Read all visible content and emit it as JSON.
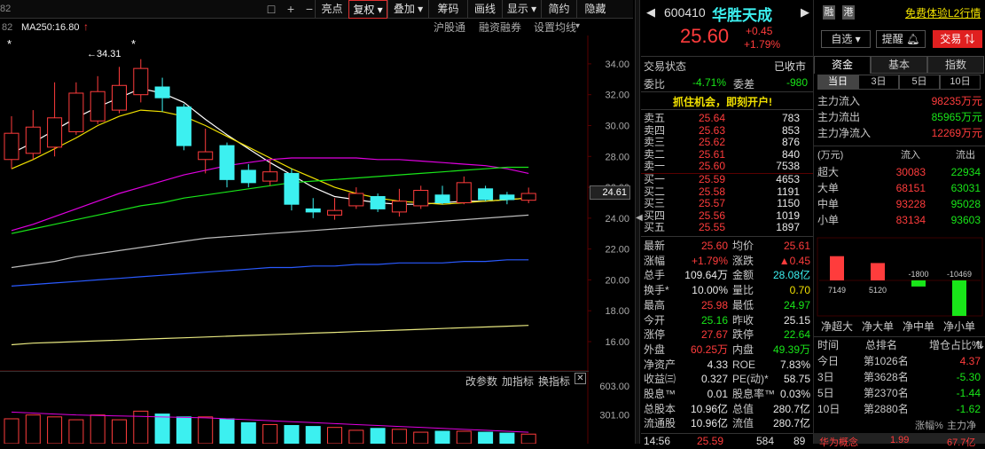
{
  "toolbar": {
    "left_num": "82",
    "icons": [
      "□",
      "+",
      "−"
    ],
    "buttons": [
      "亮点",
      "复权",
      "叠加",
      "筹码",
      "画线",
      "显示",
      "简约",
      "隐藏"
    ],
    "active": "复权"
  },
  "ma_label": "MA250:16.80",
  "sub_links": [
    "沪股通",
    "融资融券",
    "设置均线"
  ],
  "price_marker": "24.61",
  "high_label": "34.31",
  "ind_links": [
    "改参数",
    "加指标",
    "换指标"
  ],
  "chart_data": [
    {
      "type": "candlestick",
      "y_ticks": [
        "34.00",
        "32.00",
        "30.00",
        "28.00",
        "26.00",
        "24.00",
        "22.00",
        "20.00",
        "18.00",
        "16.00"
      ],
      "ylim": [
        16.0,
        34.8
      ],
      "candles": [
        {
          "o": 27.8,
          "c": 29.5,
          "h": 30.6,
          "l": 27.2
        },
        {
          "o": 28.2,
          "c": 29.9,
          "h": 31.0,
          "l": 27.8
        },
        {
          "o": 28.6,
          "c": 30.5,
          "h": 32.8,
          "l": 28.0
        },
        {
          "o": 29.6,
          "c": 32.1,
          "h": 32.8,
          "l": 29.4
        },
        {
          "o": 30.3,
          "c": 32.2,
          "h": 33.2,
          "l": 30.1
        },
        {
          "o": 31.0,
          "c": 32.6,
          "h": 33.8,
          "l": 30.8
        },
        {
          "o": 32.0,
          "c": 33.7,
          "h": 34.3,
          "l": 31.5
        },
        {
          "o": 32.5,
          "c": 31.8,
          "h": 33.1,
          "l": 30.9
        },
        {
          "o": 31.2,
          "c": 28.7,
          "h": 31.4,
          "l": 28.4
        },
        {
          "o": 27.8,
          "c": 28.3,
          "h": 29.8,
          "l": 26.9
        },
        {
          "o": 28.7,
          "c": 26.5,
          "h": 28.9,
          "l": 26.0
        },
        {
          "o": 27.1,
          "c": 26.3,
          "h": 27.5,
          "l": 26.0
        },
        {
          "o": 26.4,
          "c": 27.0,
          "h": 27.8,
          "l": 26.1
        },
        {
          "o": 26.9,
          "c": 24.9,
          "h": 27.2,
          "l": 24.5
        },
        {
          "o": 24.6,
          "c": 24.4,
          "h": 25.3,
          "l": 24.0
        },
        {
          "o": 24.2,
          "c": 24.5,
          "h": 25.3,
          "l": 23.9
        },
        {
          "o": 24.8,
          "c": 25.6,
          "h": 26.0,
          "l": 24.6
        },
        {
          "o": 25.4,
          "c": 24.6,
          "h": 25.6,
          "l": 24.4
        },
        {
          "o": 24.4,
          "c": 25.1,
          "h": 25.9,
          "l": 24.1
        },
        {
          "o": 24.8,
          "c": 25.8,
          "h": 26.1,
          "l": 24.6
        },
        {
          "o": 25.5,
          "c": 25.0,
          "h": 26.1,
          "l": 24.9
        },
        {
          "o": 25.0,
          "c": 26.3,
          "h": 26.7,
          "l": 24.9
        },
        {
          "o": 25.9,
          "c": 25.2,
          "h": 26.1,
          "l": 25.1
        },
        {
          "o": 25.5,
          "c": 25.2,
          "h": 25.7,
          "l": 24.9
        },
        {
          "o": 25.16,
          "c": 25.6,
          "h": 25.98,
          "l": 24.97
        }
      ],
      "lines": [
        {
          "color": "#ffffff",
          "values": [
            28.2,
            28.9,
            29.7,
            30.5,
            31.2,
            31.8,
            32.4,
            32.1,
            31.5,
            30.4,
            29.4,
            28.5,
            27.6,
            26.8,
            26.0,
            25.4,
            25.2,
            25.0,
            24.9,
            24.9,
            25.0,
            25.1,
            25.1,
            25.2,
            25.3
          ]
        },
        {
          "color": "#f0e000",
          "values": [
            27.2,
            27.8,
            28.5,
            29.2,
            30.0,
            30.6,
            31.0,
            30.9,
            30.6,
            30.0,
            29.3,
            28.6,
            27.9,
            27.2,
            26.6,
            26.0,
            25.6,
            25.3,
            25.1,
            25.0,
            24.9,
            25.0,
            25.1,
            25.2,
            25.3
          ]
        },
        {
          "color": "#e000e0",
          "values": [
            23.2,
            23.6,
            24.1,
            24.6,
            25.1,
            25.6,
            26.0,
            26.4,
            26.8,
            27.1,
            27.4,
            27.6,
            27.8,
            27.9,
            27.9,
            27.9,
            27.9,
            27.8,
            27.8,
            27.7,
            27.6,
            27.5,
            27.4,
            27.2,
            26.9
          ]
        },
        {
          "color": "#19e619",
          "values": [
            23.0,
            23.3,
            23.6,
            23.9,
            24.2,
            24.5,
            24.8,
            25.0,
            25.3,
            25.5,
            25.7,
            25.9,
            26.1,
            26.3,
            26.4,
            26.5,
            26.6,
            26.7,
            26.8,
            26.9,
            27.0,
            27.1,
            27.2,
            27.3,
            27.3
          ]
        },
        {
          "color": "#bbbbbb",
          "values": [
            20.8,
            21.0,
            21.2,
            21.5,
            21.7,
            21.9,
            22.1,
            22.3,
            22.5,
            22.7,
            22.8,
            22.9,
            23.0,
            23.1,
            23.2,
            23.3,
            23.4,
            23.5,
            23.6,
            23.7,
            23.8,
            23.9,
            24.0,
            24.1,
            24.2
          ]
        },
        {
          "color": "#2a5aff",
          "values": [
            19.6,
            19.7,
            19.8,
            19.9,
            20.0,
            20.1,
            20.2,
            20.3,
            20.4,
            20.5,
            20.6,
            20.7,
            20.8,
            20.8,
            20.9,
            20.9,
            21.0,
            21.0,
            21.1,
            21.1,
            21.1,
            21.2,
            21.2,
            21.3,
            21.3
          ]
        },
        {
          "color": "#e8e880",
          "values": [
            15.8,
            15.9,
            15.95,
            16.0,
            16.05,
            16.1,
            16.15,
            16.2,
            16.25,
            16.3,
            16.35,
            16.4,
            16.45,
            16.5,
            16.55,
            16.6,
            16.65,
            16.7,
            16.75,
            16.8,
            16.85,
            16.9,
            16.95,
            17.0,
            17.05
          ]
        }
      ]
    },
    {
      "type": "bar",
      "y_ticks": [
        "603.00",
        "301.00"
      ],
      "ylim": [
        0,
        603
      ],
      "volumes": [
        260,
        300,
        280,
        250,
        300,
        250,
        340,
        310,
        280,
        280,
        260,
        220,
        200,
        190,
        180,
        170,
        140,
        160,
        150,
        120,
        130,
        130,
        120,
        110,
        100
      ],
      "ma_line": [
        330,
        320,
        310,
        300,
        295,
        290,
        285,
        280,
        275,
        270,
        260,
        250,
        240,
        230,
        220,
        210,
        200,
        190,
        180,
        170,
        160,
        150,
        140,
        130,
        120
      ]
    }
  ],
  "quote": {
    "code": "600410",
    "name": "华胜天成",
    "badges": [
      "融",
      "港"
    ],
    "promo": "免费体验L2行情",
    "price": "25.60",
    "change": "+0.45",
    "change_pct": "+1.79%",
    "buttons": [
      "自选",
      "提醒",
      "交易"
    ],
    "status_label": "交易状态",
    "status": "已收市",
    "weibi_label": "委比",
    "weibi": "-4.71%",
    "weicha_label": "委差",
    "weicha": "-980",
    "ad": "抓住机会，即刻开户!"
  },
  "asks": [
    {
      "label": "卖五",
      "price": "25.64",
      "vol": "783"
    },
    {
      "label": "卖四",
      "price": "25.63",
      "vol": "853"
    },
    {
      "label": "卖三",
      "price": "25.62",
      "vol": "876"
    },
    {
      "label": "卖二",
      "price": "25.61",
      "vol": "840"
    },
    {
      "label": "卖一",
      "price": "25.60",
      "vol": "7538"
    }
  ],
  "bids": [
    {
      "label": "买一",
      "price": "25.59",
      "vol": "4653"
    },
    {
      "label": "买二",
      "price": "25.58",
      "vol": "1191"
    },
    {
      "label": "买三",
      "price": "25.57",
      "vol": "1150"
    },
    {
      "label": "买四",
      "price": "25.56",
      "vol": "1019"
    },
    {
      "label": "买五",
      "price": "25.55",
      "vol": "1897"
    }
  ],
  "stats": [
    {
      "l1": "最新",
      "v1": "25.60",
      "c1": "red",
      "l2": "均价",
      "v2": "25.61",
      "c2": "red"
    },
    {
      "l1": "涨幅",
      "v1": "+1.79%",
      "c1": "red",
      "l2": "涨跌",
      "v2": "▲0.45",
      "c2": "red"
    },
    {
      "l1": "总手",
      "v1": "109.64万",
      "c1": "white",
      "l2": "金额",
      "v2": "28.08亿",
      "c2": "cyan"
    },
    {
      "l1": "换手*",
      "v1": "10.00%",
      "c1": "white",
      "l2": "量比",
      "v2": "0.70",
      "c2": "yellow"
    },
    {
      "l1": "最高",
      "v1": "25.98",
      "c1": "red",
      "l2": "最低",
      "v2": "24.97",
      "c2": "green"
    },
    {
      "l1": "今开",
      "v1": "25.16",
      "c1": "green",
      "l2": "昨收",
      "v2": "25.15",
      "c2": "white"
    },
    {
      "l1": "涨停",
      "v1": "27.67",
      "c1": "red",
      "l2": "跌停",
      "v2": "22.64",
      "c2": "green"
    },
    {
      "l1": "外盘",
      "v1": "60.25万",
      "c1": "red",
      "l2": "内盘",
      "v2": "49.39万",
      "c2": "green"
    },
    {
      "l1": "净资产",
      "v1": "4.33",
      "c1": "white",
      "l2": "ROE",
      "v2": "7.83%",
      "c2": "white"
    },
    {
      "l1": "收益㈢",
      "v1": "0.327",
      "c1": "white",
      "l2": "PE(动)*",
      "v2": "58.75",
      "c2": "white"
    },
    {
      "l1": "股息™",
      "v1": "0.01",
      "c1": "white",
      "l2": "股息率™",
      "v2": "0.03%",
      "c2": "white"
    },
    {
      "l1": "总股本",
      "v1": "10.96亿",
      "c1": "white",
      "l2": "总值",
      "v2": "280.7亿",
      "c2": "white"
    },
    {
      "l1": "流通股",
      "v1": "10.96亿",
      "c1": "white",
      "l2": "流值",
      "v2": "280.7亿",
      "c2": "white"
    }
  ],
  "tick": {
    "time": "14:56",
    "price": "25.59",
    "vol": "584",
    "n": "89"
  },
  "fund": {
    "tabs": [
      "资金",
      "基本",
      "指数"
    ],
    "periods": [
      "当日",
      "3日",
      "5日",
      "10日"
    ],
    "flows": [
      {
        "label": "主力流入",
        "value": "98235万元",
        "color": "red"
      },
      {
        "label": "主力流出",
        "value": "85965万元",
        "color": "green"
      },
      {
        "label": "主力净流入",
        "value": "12269万元",
        "color": "red"
      }
    ],
    "table_head": [
      "(万元)",
      "流入",
      "流出"
    ],
    "table": [
      {
        "label": "超大",
        "in": "30083",
        "out": "22934"
      },
      {
        "label": "大单",
        "in": "68151",
        "out": "63031"
      },
      {
        "label": "中单",
        "in": "93228",
        "out": "95028"
      },
      {
        "label": "小单",
        "in": "83134",
        "out": "93603"
      }
    ],
    "net_bars": [
      {
        "label": "净超大",
        "value": 7149
      },
      {
        "label": "净大单",
        "value": 5120
      },
      {
        "label": "净中单",
        "value": -1800
      },
      {
        "label": "净小单",
        "value": -10469
      }
    ],
    "rank_head": [
      "时间",
      "总排名",
      "增仓占比%"
    ],
    "ranks": [
      {
        "period": "今日",
        "rank": "第1026名",
        "pct": "4.37",
        "c": "red"
      },
      {
        "period": "3日",
        "rank": "第3628名",
        "pct": "-5.30",
        "c": "green"
      },
      {
        "period": "5日",
        "rank": "第2370名",
        "pct": "-1.44",
        "c": "green"
      },
      {
        "period": "10日",
        "rank": "第2880名",
        "pct": "-1.62",
        "c": "green"
      }
    ],
    "bottom": [
      "华为概念",
      "1.99",
      "67.7亿"
    ]
  }
}
